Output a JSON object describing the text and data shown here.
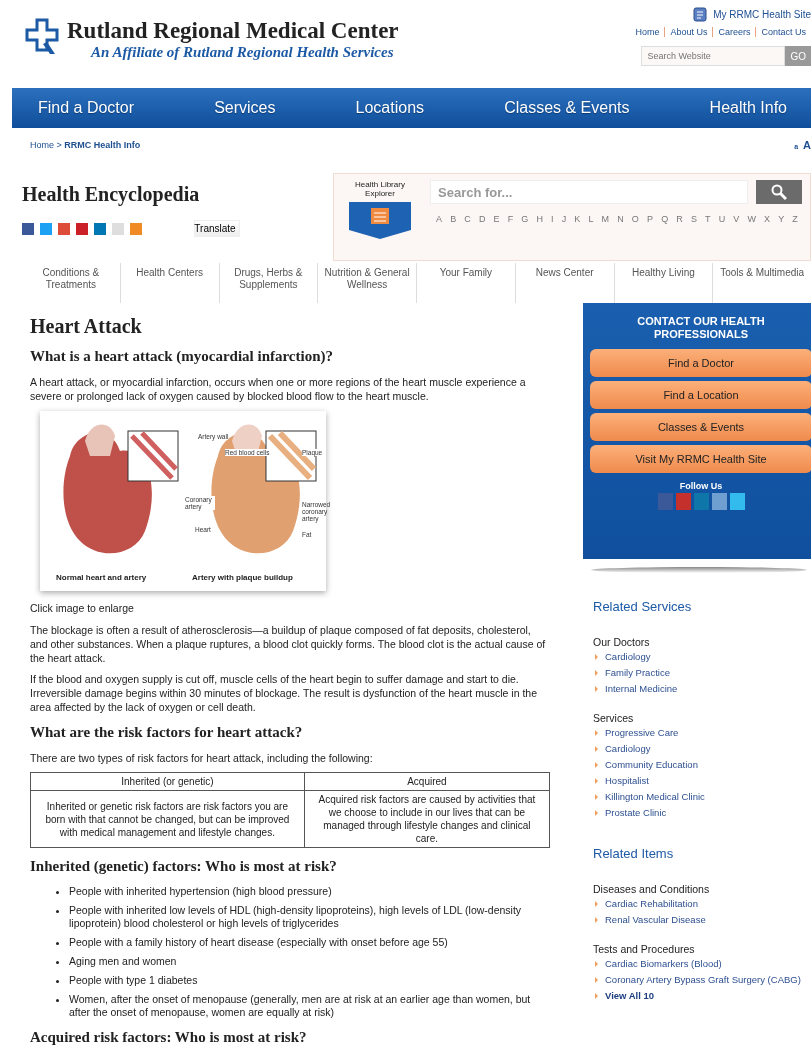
{
  "header": {
    "title": "Rutland Regional Medical Center",
    "tagline": "An Affiliate of Rutland Regional Health Services",
    "portal_link": "My RRMC Health Site",
    "utility_links": [
      "Home",
      "About Us",
      "Careers",
      "Contact Us"
    ],
    "search": {
      "placeholder": "Search Website",
      "button": "GO"
    }
  },
  "nav": [
    "Find a Doctor",
    "Services",
    "Locations",
    "Classes & Events",
    "Health Info"
  ],
  "breadcrumb": {
    "items": [
      "Home",
      "RRMC Health Info"
    ],
    "separator": ">"
  },
  "text_size": [
    "a",
    "A"
  ],
  "encyclopedia": {
    "title": "Health Encyclopedia",
    "translate": "Translate",
    "explorer": "Health Library Explorer",
    "search_placeholder": "Search for...",
    "alphabet": [
      "A",
      "B",
      "C",
      "D",
      "E",
      "F",
      "G",
      "H",
      "I",
      "J",
      "K",
      "L",
      "M",
      "N",
      "O",
      "P",
      "Q",
      "R",
      "S",
      "T",
      "U",
      "V",
      "W",
      "X",
      "Y",
      "Z"
    ],
    "tabs": [
      "Conditions & Treatments",
      "Health Centers",
      "Drugs, Herbs & Supplements",
      "Nutrition & General Wellness",
      "Your Family",
      "News Center",
      "Healthy Living",
      "Tools & Multimedia"
    ]
  },
  "article": {
    "title": "Heart Attack",
    "blocks": [
      {
        "kind": "heading",
        "text": "What is a heart attack (myocardial infarction)?"
      },
      {
        "kind": "paragraph",
        "text": "A heart attack, or myocardial infarction, occurs when one or more regions of the heart muscle experience a severe or prolonged lack of oxygen caused by blocked blood flow to the heart muscle."
      },
      {
        "kind": "figure",
        "labels": [
          "Artery wall",
          "Red blood cells",
          "Plaque",
          "Coronary artery",
          "Narrowed coronary artery",
          "Heart",
          "Fat"
        ],
        "captions": [
          "Normal heart and artery",
          "Artery with plaque buildup"
        ],
        "note": "Click image to enlarge"
      },
      {
        "kind": "paragraph",
        "text": "The blockage is often a result of atherosclerosis—a buildup of plaque composed of fat deposits, cholesterol, and other substances. When a plaque ruptures, a blood clot quickly forms. The blood clot is the actual cause of the heart attack."
      },
      {
        "kind": "paragraph",
        "text": "If the blood and oxygen supply is cut off, muscle cells of the heart begin to suffer damage and start to die. Irreversible damage begins within 30 minutes of blockage. The result is dysfunction of the heart muscle in the area affected by the lack of oxygen or cell death."
      },
      {
        "kind": "heading",
        "text": "What are the risk factors for heart attack?"
      },
      {
        "kind": "paragraph",
        "text": "There are two types of risk factors for heart attack, including the following:"
      },
      {
        "kind": "table",
        "columns": [
          "Inherited (or genetic)",
          "Acquired"
        ],
        "rows": [
          [
            "Inherited or genetic risk factors are risk factors you are born with that cannot be changed, but can be improved with medical management and lifestyle changes.",
            "Acquired risk factors are caused by activities that we choose to include in our lives that can be managed through lifestyle changes and clinical care."
          ]
        ]
      },
      {
        "kind": "heading",
        "text": "Inherited (genetic) factors: Who is most at risk?"
      },
      {
        "kind": "list",
        "items": [
          "People with inherited hypertension (high blood pressure)",
          "People with inherited low levels of HDL (high-density lipoproteins), high levels of LDL (low-density lipoprotein) blood cholesterol or high levels of triglycerides",
          "People with a family history of heart disease (especially with onset before age 55)",
          "Aging men and women",
          "People with type 1 diabetes",
          "Women, after the onset of menopause (generally, men are at risk at an earlier age than women, but after the onset of menopause, women are equally at risk)"
        ]
      },
      {
        "kind": "heading",
        "text": "Acquired risk factors: Who is most at risk?"
      }
    ]
  },
  "sidebar": {
    "contact": {
      "title": "CONTACT OUR HEALTH PROFESSIONALS",
      "buttons": [
        "Find a Doctor",
        "Find a Location",
        "Classes & Events",
        "Visit My RRMC Health Site"
      ],
      "follow": "Follow Us"
    },
    "sections": [
      {
        "title": "Related Services",
        "groups": [
          {
            "title": "Our Doctors",
            "links": [
              "Cardiology",
              "Family Practice",
              "Internal Medicine"
            ]
          },
          {
            "title": "Services",
            "links": [
              "Progressive Care",
              "Cardiology",
              "Community Education",
              "Hospitalist",
              "Killington Medical Clinic",
              "Prostate Clinic"
            ]
          }
        ]
      },
      {
        "title": "Related Items",
        "groups": [
          {
            "title": "Diseases and Conditions",
            "links": [
              "Cardiac Rehabilitation",
              "Renal Vascular Disease"
            ]
          },
          {
            "title": "Tests and Procedures",
            "links": [
              "Cardiac Biomarkers (Blood)",
              "Coronary Artery Bypass Graft Surgery (CABG)"
            ],
            "view_all": "View All 10"
          }
        ]
      }
    ]
  }
}
